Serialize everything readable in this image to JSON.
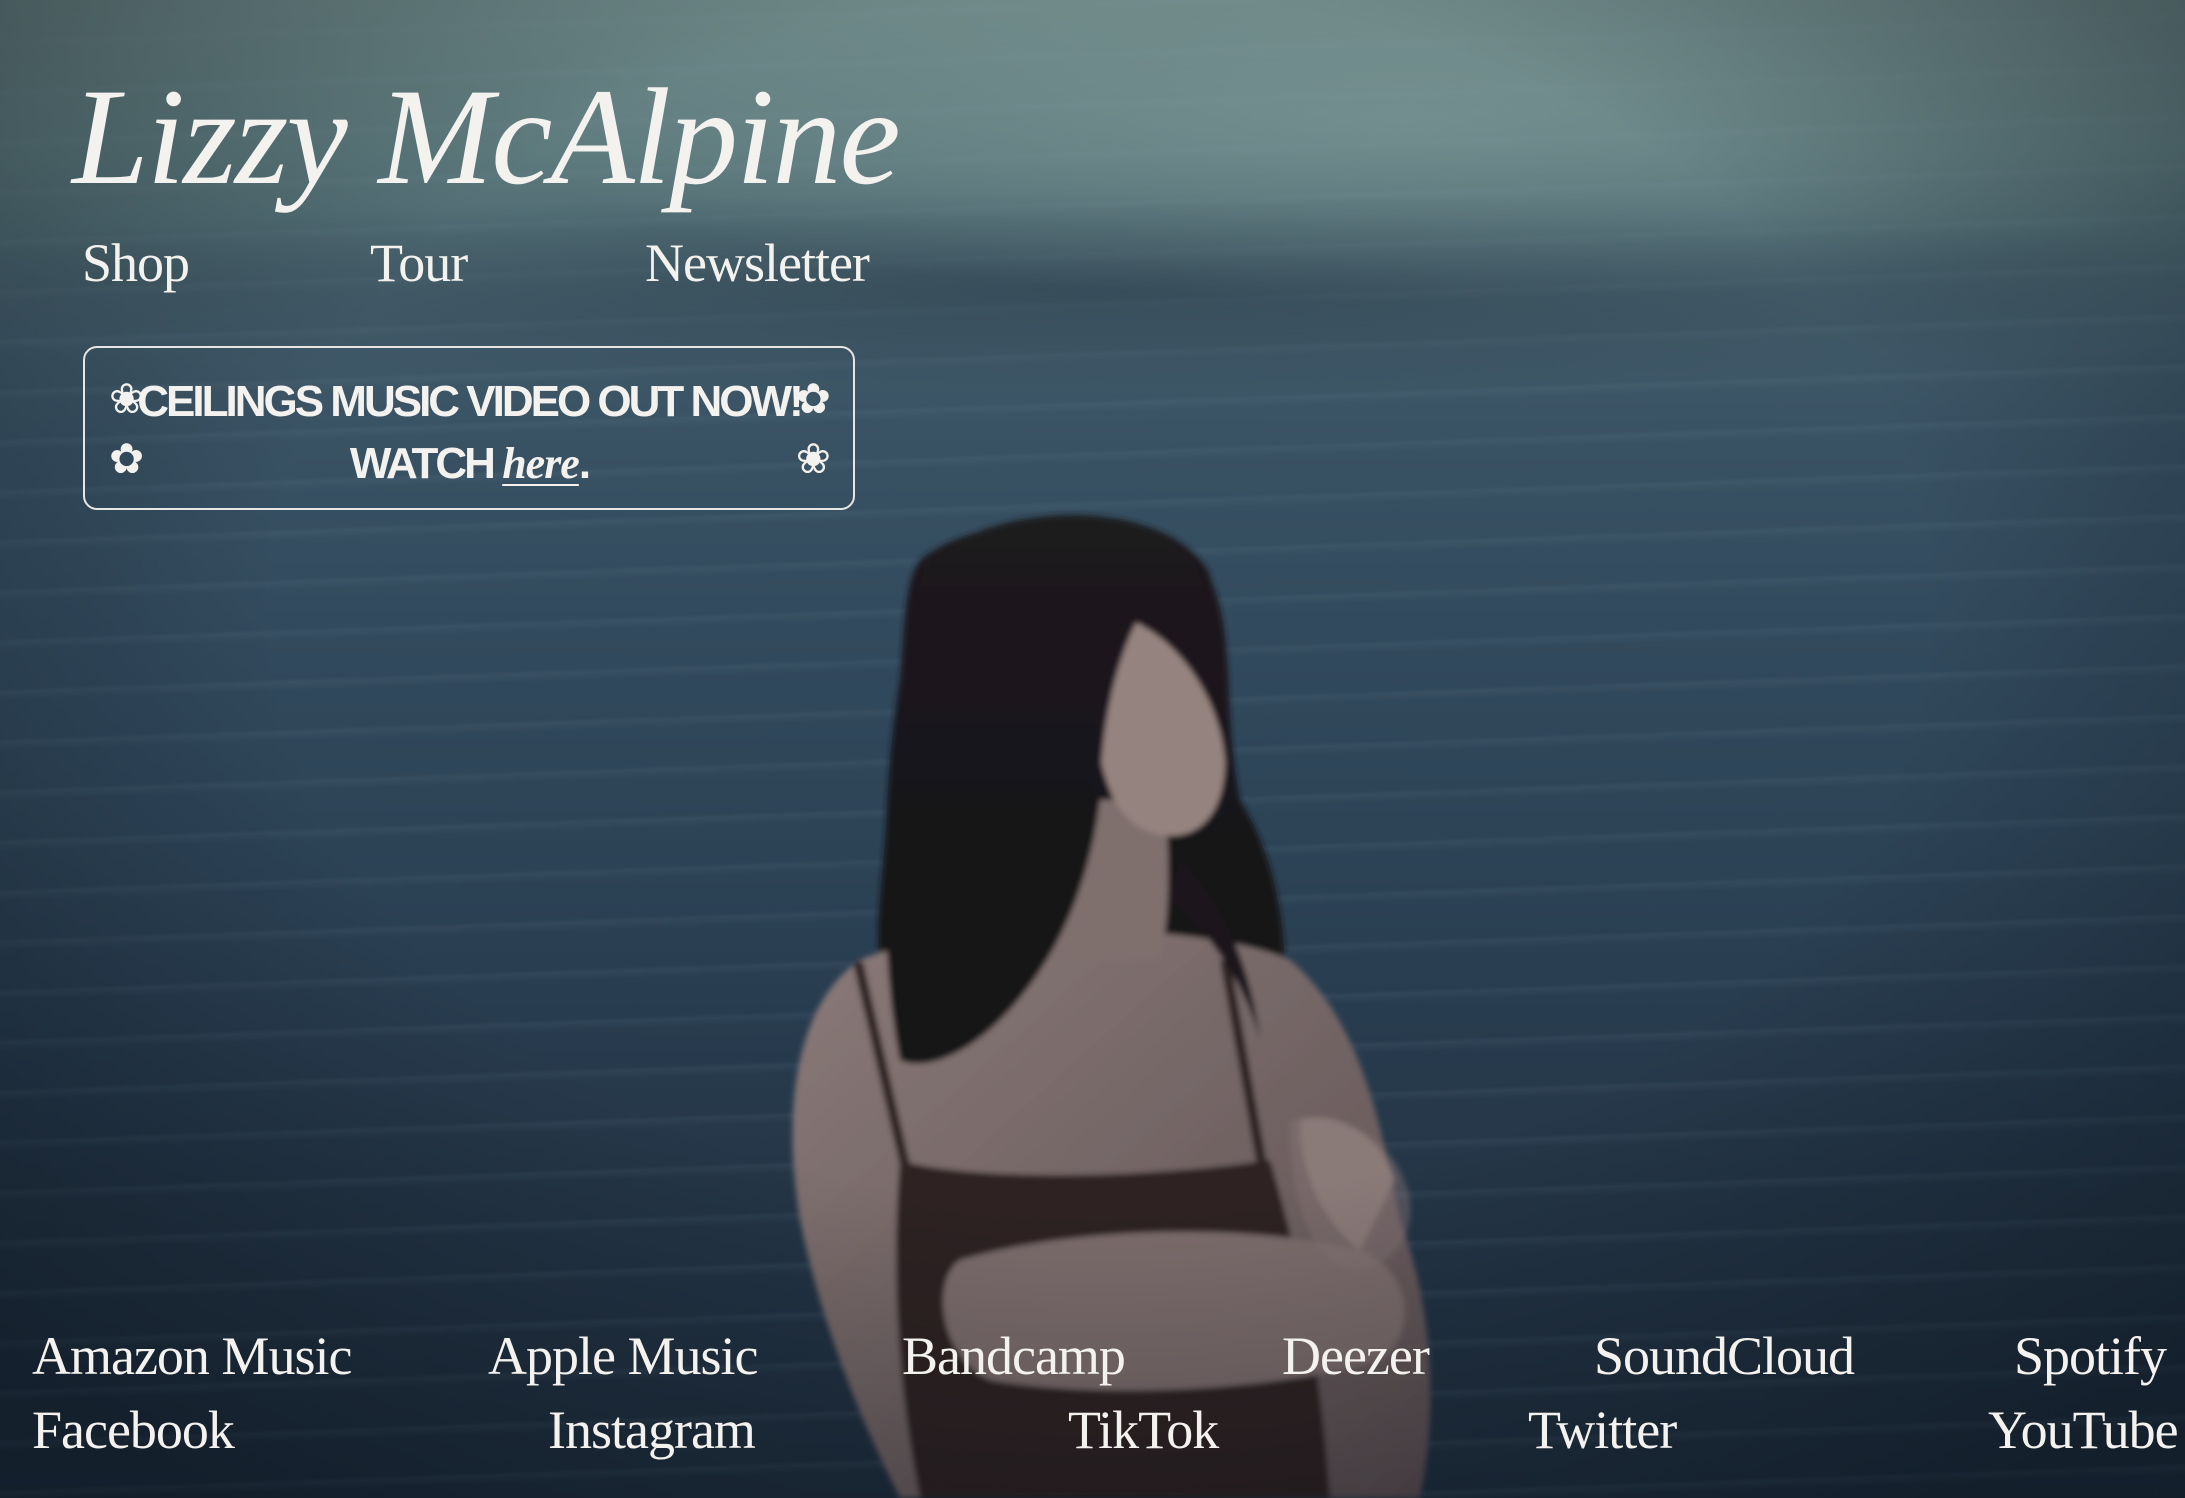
{
  "site": {
    "title": "Lizzy McAlpine"
  },
  "nav": {
    "items": [
      "Shop",
      "Tour",
      "Newsletter"
    ]
  },
  "banner": {
    "line1": "CEILINGS MUSIC VIDEO OUT NOW!",
    "line2_prefix": "WATCH ",
    "link_text": "here",
    "line2_suffix": ".",
    "flower_a": "❀",
    "flower_b": "✿"
  },
  "streaming_links": [
    "Amazon Music",
    "Apple Music",
    "Bandcamp",
    "Deezer",
    "SoundCloud",
    "Spotify"
  ],
  "social_links": [
    "Facebook",
    "Instagram",
    "TikTok",
    "Twitter",
    "YouTube"
  ],
  "colors": {
    "text": "#f4f2ee",
    "sky": "#6c8686",
    "sea": "#2d4457"
  },
  "background_image": "woman-by-the-sea-photo"
}
